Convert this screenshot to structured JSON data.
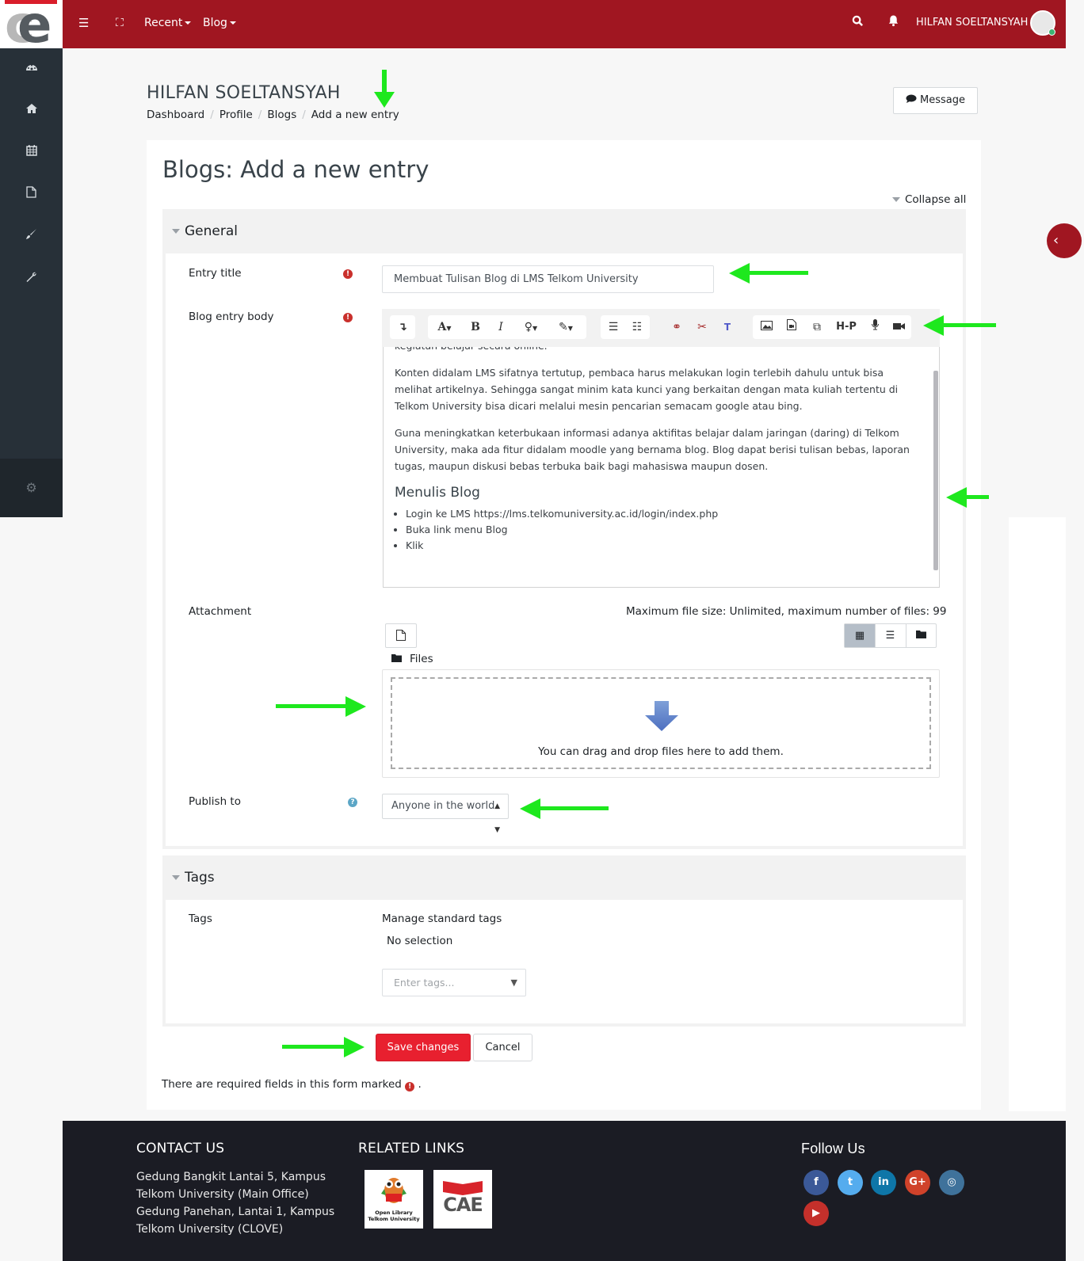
{
  "navbar": {
    "menu_icon": "hamburger-icon",
    "fullscreen_icon": "expand-icon",
    "recent_label": "Recent",
    "blog_label": "Blog",
    "search_icon": "search-icon",
    "notifications_icon": "bell-icon",
    "user_name": "HILFAN SOELTANSYAH",
    "brand_color": "#a01621"
  },
  "sidebar": {
    "items": [
      {
        "icon": "dashboard-icon",
        "label": "Dashboard"
      },
      {
        "icon": "home-icon",
        "label": "Home"
      },
      {
        "icon": "calendar-icon",
        "label": "Calendar"
      },
      {
        "icon": "file-icon",
        "label": "Private files"
      },
      {
        "icon": "paintbrush-icon",
        "label": "Themes"
      },
      {
        "icon": "wrench-icon",
        "label": "Settings"
      }
    ],
    "bottom_icon": "cogs-icon"
  },
  "header": {
    "name": "HILFAN SOELTANSYAH",
    "breadcrumb": [
      "Dashboard",
      "Profile",
      "Blogs",
      "Add a new entry"
    ],
    "message_button": "Message"
  },
  "main": {
    "title": "Blogs: Add a new entry",
    "collapse_all": "Collapse all",
    "general": {
      "legend": "General",
      "entry_title_label": "Entry title",
      "entry_title_value": "Membuat Tulisan Blog di LMS Telkom University",
      "body_label": "Blog entry body",
      "body": {
        "first_line": "kegiatan belajar secara online.",
        "p1": "Konten didalam LMS sifatnya tertutup, pembaca harus melakukan login terlebih dahulu untuk bisa melihat artikelnya. Sehingga sangat minim kata kunci yang berkaitan dengan mata kuliah tertentu di Telkom University bisa dicari melalui mesin pencarian semacam google atau bing.",
        "p2": "Guna meningkatkan keterbukaan informasi adanya aktifitas belajar dalam jaringan (daring) di Telkom University, maka ada fitur didalam moodle yang bernama blog. Blog dapat berisi tulisan bebas, laporan tugas, maupun diskusi bebas terbuka baik bagi mahasiswa maupun dosen.",
        "heading": "Menulis Blog",
        "list": [
          "Login ke LMS https://lms.telkomuniversity.ac.id/login/index.php",
          "Buka link menu Blog",
          "Klik"
        ]
      },
      "attachment_label": "Attachment",
      "max_file_text": "Maximum file size: Unlimited, maximum number of files: 99",
      "files_label": "Files",
      "drop_text": "You can drag and drop files here to add them.",
      "publish_label": "Publish to",
      "publish_value": "Anyone in the world"
    },
    "tags": {
      "legend": "Tags",
      "label": "Tags",
      "manage": "Manage standard tags",
      "no_selection": "No selection",
      "placeholder": "Enter tags..."
    },
    "save_button": "Save changes",
    "cancel_button": "Cancel",
    "required_note": "There are required fields in this form marked",
    "required_note_end": "."
  },
  "editor_toolbar": {
    "buttons": [
      "collapse",
      "font-style",
      "bold",
      "italic",
      "lightbulb",
      "paintbrush",
      "unordered-list",
      "ordered-list",
      "link",
      "unlink",
      "teams-meeting",
      "image",
      "media",
      "manage-files",
      "h5p",
      "record-audio",
      "record-video"
    ],
    "bold_label": "B",
    "italic_label": "I",
    "font_label": "A",
    "h5p_label": "H-P"
  },
  "footer": {
    "contact_heading": "CONTACT US",
    "contact_lines": [
      "Gedung Bangkit Lantai 5, Kampus",
      "Telkom University (Main Office)",
      "Gedung Panehan, Lantai 1, Kampus",
      "Telkom University (CLOVE)"
    ],
    "related_heading": "RELATED LINKS",
    "related_links": [
      {
        "name": "Open Library Telkom University",
        "line1": "Open Library",
        "line2": "Telkom University"
      },
      {
        "name": "CAE",
        "label": "CAE"
      }
    ],
    "follow_heading": "Follow Us",
    "social": [
      {
        "name": "facebook",
        "glyph": "f",
        "color": "#3b5998"
      },
      {
        "name": "twitter",
        "glyph": "t",
        "color": "#55acee"
      },
      {
        "name": "linkedin",
        "glyph": "in",
        "color": "#0e76a8"
      },
      {
        "name": "google-plus",
        "glyph": "G+",
        "color": "#d0422a"
      },
      {
        "name": "instagram",
        "glyph": "◎",
        "color": "#3f729b"
      },
      {
        "name": "youtube",
        "glyph": "▶",
        "color": "#c4302b"
      }
    ]
  }
}
